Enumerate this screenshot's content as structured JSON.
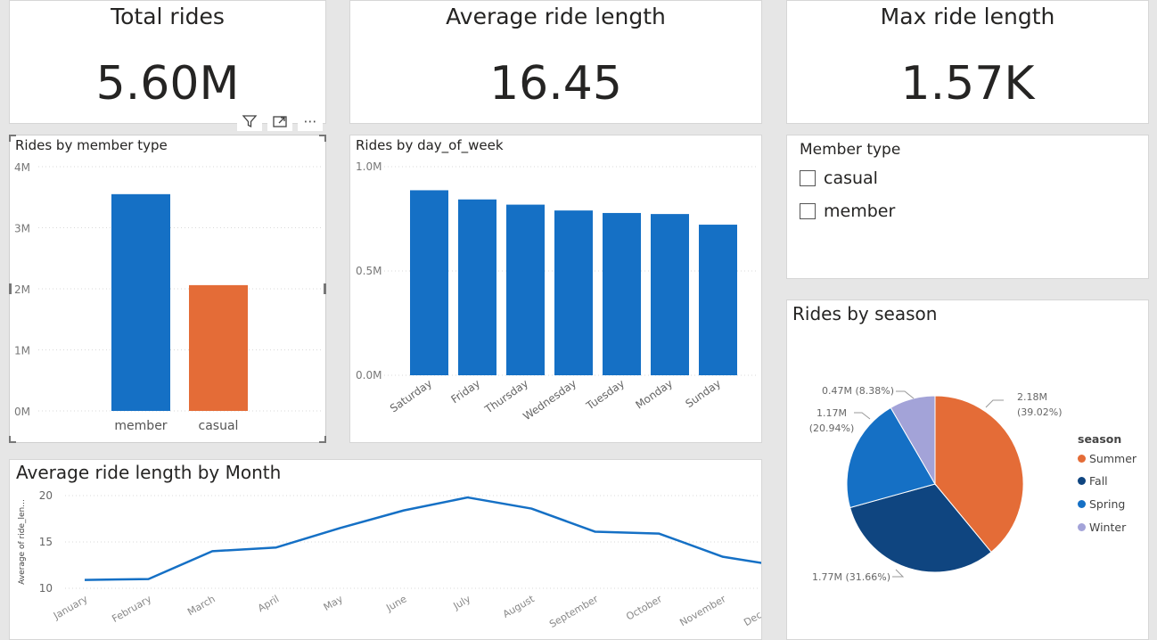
{
  "cards": [
    {
      "title": "Total rides",
      "value": "5.60M"
    },
    {
      "title": "Average ride length",
      "value": "16.45"
    },
    {
      "title": "Max ride length",
      "value": "1.57K"
    }
  ],
  "header_icons": {
    "filter": "filter-icon",
    "focus": "focus-mode-icon",
    "more": "more-options-icon",
    "more_glyph": "⋯"
  },
  "member_chart": {
    "title": "Rides by member type",
    "chart_data": {
      "type": "bar",
      "categories": [
        "member",
        "casual"
      ],
      "values": [
        3550000,
        2060000
      ],
      "colors": [
        "#1570c5",
        "#e46c37"
      ],
      "ylim": [
        0,
        4000000
      ],
      "yticks": [
        0,
        1000000,
        2000000,
        3000000,
        4000000
      ],
      "ytick_labels": [
        "0M",
        "1M",
        "2M",
        "3M",
        "4M"
      ]
    }
  },
  "day_chart": {
    "title": "Rides by day_of_week",
    "chart_data": {
      "type": "bar",
      "categories": [
        "Saturday",
        "Friday",
        "Thursday",
        "Wednesday",
        "Tuesday",
        "Monday",
        "Sunday"
      ],
      "values": [
        887000,
        843000,
        818000,
        790000,
        778000,
        773000,
        722000
      ],
      "color": "#1570c5",
      "ylim": [
        0,
        1000000
      ],
      "yticks": [
        0,
        500000,
        1000000
      ],
      "ytick_labels": [
        "0.0M",
        "0.5M",
        "1.0M"
      ]
    }
  },
  "slicer": {
    "title": "Member type",
    "options": [
      "casual",
      "member"
    ]
  },
  "season_chart": {
    "title": "Rides by season",
    "chart_data": {
      "type": "pie",
      "legend_title": "season",
      "legend_position": "right",
      "slices": [
        {
          "name": "Summer",
          "value": 2180000,
          "percent": 39.02,
          "label1": "2.18M",
          "label2": "(39.02%)",
          "color": "#e46c37"
        },
        {
          "name": "Fall",
          "value": 1770000,
          "percent": 31.66,
          "label1": "1.77M (31.66%)",
          "label2": "",
          "color": "#0f4580"
        },
        {
          "name": "Spring",
          "value": 1170000,
          "percent": 20.94,
          "label1": "1.17M",
          "label2": "(20.94%)",
          "color": "#1570c5"
        },
        {
          "name": "Winter",
          "value": 470000,
          "percent": 8.38,
          "label1": "0.47M (8.38%)",
          "label2": "",
          "color": "#a3a3d8"
        }
      ]
    }
  },
  "month_chart": {
    "title": "Average ride length by Month",
    "chart_data": {
      "type": "line",
      "ylabel": "Average of ride_len...",
      "x": [
        "January",
        "February",
        "March",
        "April",
        "May",
        "June",
        "July",
        "August",
        "September",
        "October",
        "November",
        "December"
      ],
      "values": [
        10.9,
        11.0,
        14.0,
        14.4,
        16.5,
        18.4,
        19.8,
        18.6,
        16.1,
        15.9,
        13.4,
        12.3
      ],
      "ylim": [
        10,
        20
      ],
      "yticks": [
        10,
        15,
        20
      ],
      "color": "#1570c5"
    }
  }
}
